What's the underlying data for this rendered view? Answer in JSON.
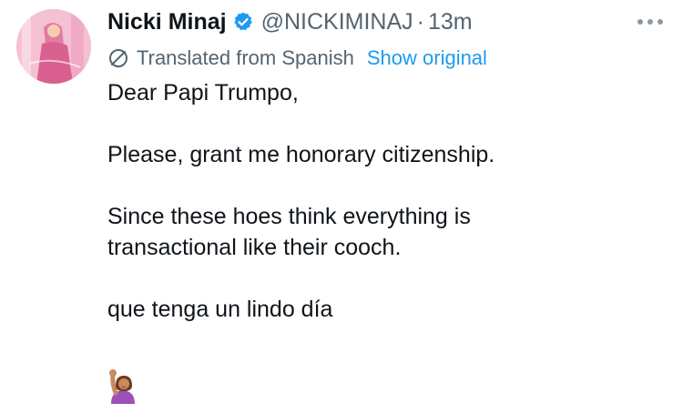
{
  "tweet": {
    "display_name": "Nicki Minaj",
    "handle": "@NICKIMINAJ",
    "separator": "·",
    "timestamp": "13m",
    "verified_icon": "verified-badge-icon",
    "more_icon": "more-options-icon",
    "translation": {
      "icon": "translate-globe-icon",
      "label": "Translated from Spanish",
      "show_original": "Show original"
    },
    "body": {
      "line1": "Dear Papi Trumpo,",
      "line2": "Please, grant me honorary citizenship.",
      "line3": "Since these hoes think everything is",
      "line4": "transactional like their cooch.",
      "line5": "que tenga un lindo día"
    },
    "emoji": "raising-hand-emoji"
  },
  "colors": {
    "primary_text": "#0f1419",
    "secondary_text": "#536471",
    "link": "#1d9bf0",
    "verified": "#1d9bf0",
    "background": "#ffffff"
  }
}
